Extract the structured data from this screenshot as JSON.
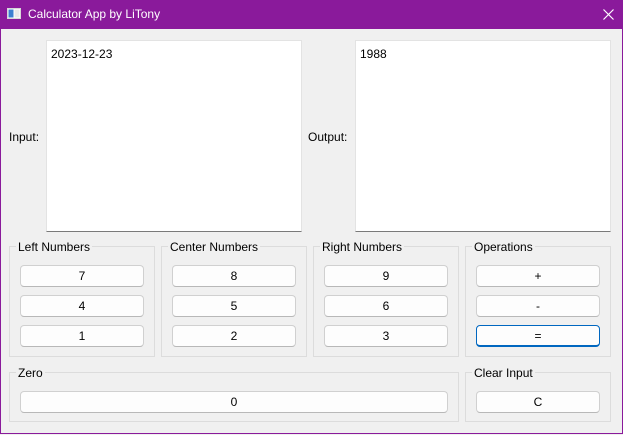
{
  "window": {
    "title": "Calculator App by LiTony",
    "accent_color": "#8a1a9b"
  },
  "io": {
    "input_label": "Input:",
    "input_value": "2023-12-23",
    "output_label": "Output:",
    "output_value": "1988"
  },
  "groups": {
    "left": {
      "title": "Left Numbers",
      "buttons": [
        "7",
        "4",
        "1"
      ]
    },
    "center": {
      "title": "Center Numbers",
      "buttons": [
        "8",
        "5",
        "2"
      ]
    },
    "right": {
      "title": "Right Numbers",
      "buttons": [
        "9",
        "6",
        "3"
      ]
    },
    "operations": {
      "title": "Operations",
      "buttons": [
        "+",
        "-",
        "="
      ]
    },
    "zero": {
      "title": "Zero",
      "buttons": [
        "0"
      ]
    },
    "clear": {
      "title": "Clear Input",
      "buttons": [
        "C"
      ]
    }
  },
  "icons": {
    "app": "app-window-icon",
    "close": "close-icon"
  }
}
